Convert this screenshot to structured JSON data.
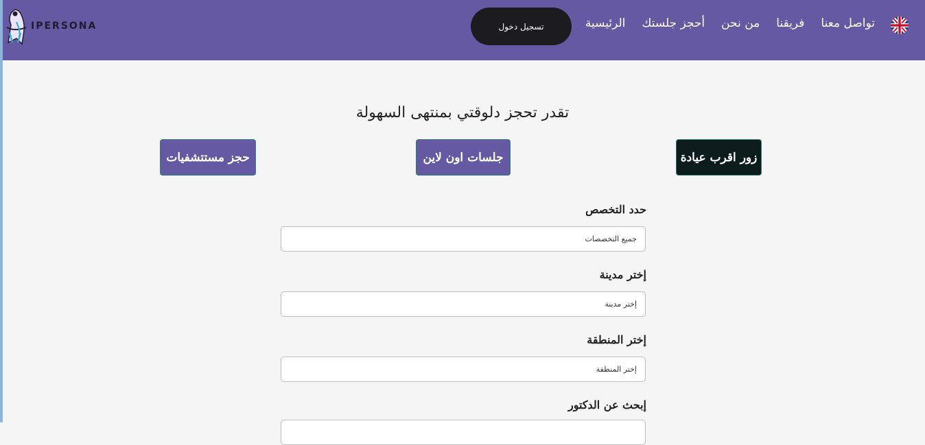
{
  "brand": {
    "name": "IPERSONA"
  },
  "header": {
    "login_label": "تسجيل دخول",
    "nav": [
      {
        "label": "الرئيسية"
      },
      {
        "label": "أحجز جلستك"
      },
      {
        "label": "من نحن"
      },
      {
        "label": "فريقنا"
      },
      {
        "label": "تواصل معنا"
      }
    ],
    "language_icon": "uk-flag-icon"
  },
  "hero": {
    "title": "تقدر تحجز دلوقتي بمنتهى السهولة",
    "modes": [
      {
        "label": "زور اقرب عيادة"
      },
      {
        "label": "جلسات اون لاين"
      },
      {
        "label": "حجز مستتشفيات"
      }
    ]
  },
  "form": {
    "specialty": {
      "label": "حدد التخصص",
      "value": "جميع التخصصات"
    },
    "city": {
      "label": "إختر مدينة",
      "placeholder": "إختر مدينة"
    },
    "area": {
      "label": "إختر المنطقة",
      "placeholder": "إختر المنطقة"
    },
    "doctor": {
      "label": "إبحث عن الدكتور"
    }
  },
  "colors": {
    "navbar": "#6459a2",
    "login": "#1b1b20",
    "active_mode": "#0c1c1c"
  }
}
